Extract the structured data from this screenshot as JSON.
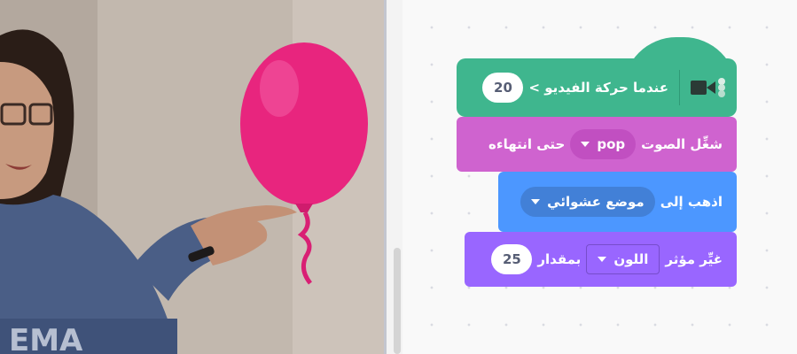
{
  "blocks": {
    "hat": {
      "label": "عندما حركة الفيديو >",
      "value": "20",
      "icon": "video-camera-icon",
      "color": "#3fb68e"
    },
    "sound": {
      "label_start": "شغِّل الصوت",
      "dropdown_value": "pop",
      "label_end": "حتى انتهاءه",
      "color": "#cf63cf"
    },
    "motion": {
      "label": "اذهب إلى",
      "dropdown_value": "موضع عشوائي",
      "color": "#4c97ff"
    },
    "looks": {
      "label_start": "غيِّر مؤثر",
      "dropdown_value": "اللون",
      "label_mid": "بمقدار",
      "value": "25",
      "color": "#9966ff"
    }
  }
}
